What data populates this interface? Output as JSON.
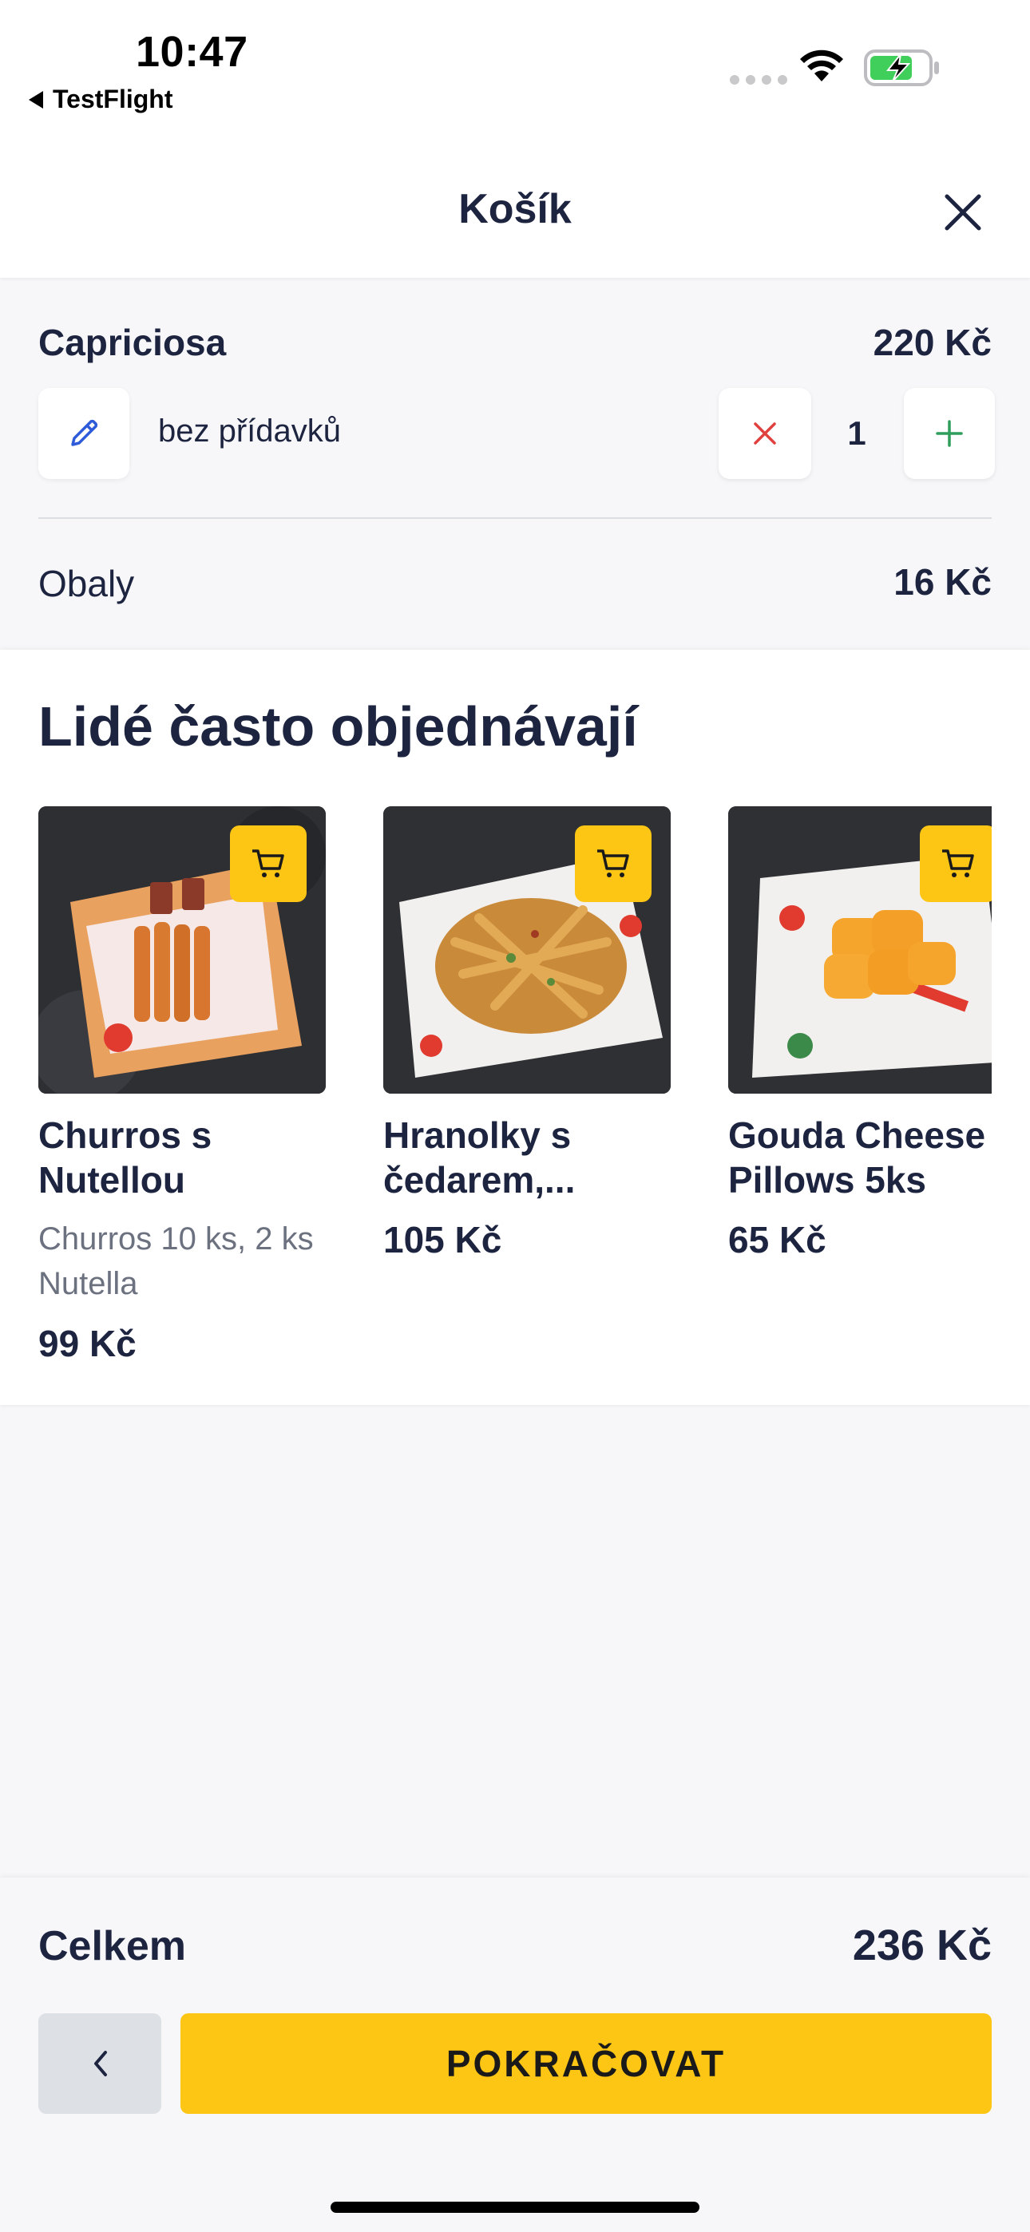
{
  "status_bar": {
    "time": "10:47",
    "back_app": "TestFlight",
    "icons": [
      "cellular-signal-icon",
      "wifi-icon",
      "battery-charging-icon"
    ]
  },
  "header": {
    "title": "Košík",
    "close_icon": "close-icon"
  },
  "cart": {
    "items": [
      {
        "name": "Capriciosa",
        "price": "220 Kč",
        "note": "bez přídavků",
        "quantity": "1"
      }
    ],
    "packaging": {
      "label": "Obaly",
      "price": "16 Kč"
    }
  },
  "recommendations": {
    "title": "Lidé často objednávají",
    "products": [
      {
        "name": "Churros s\nNutellou",
        "description": "Churros 10 ks, 2 ks Nutella",
        "price": "99 Kč"
      },
      {
        "name": "Hranolky s\nčedarem,...",
        "description": "",
        "price": "105 Kč"
      },
      {
        "name": "Gouda Cheese\nPillows 5ks",
        "description": "",
        "price": "65 Kč"
      }
    ]
  },
  "footer": {
    "total_label": "Celkem",
    "total_price": "236 Kč",
    "continue_label": "POKRAČOVAT"
  },
  "colors": {
    "accent": "#fdc514",
    "text_dark": "#1d2440",
    "remove": "#e0413e",
    "add": "#2f9e5a",
    "edit": "#2e5bd8"
  }
}
